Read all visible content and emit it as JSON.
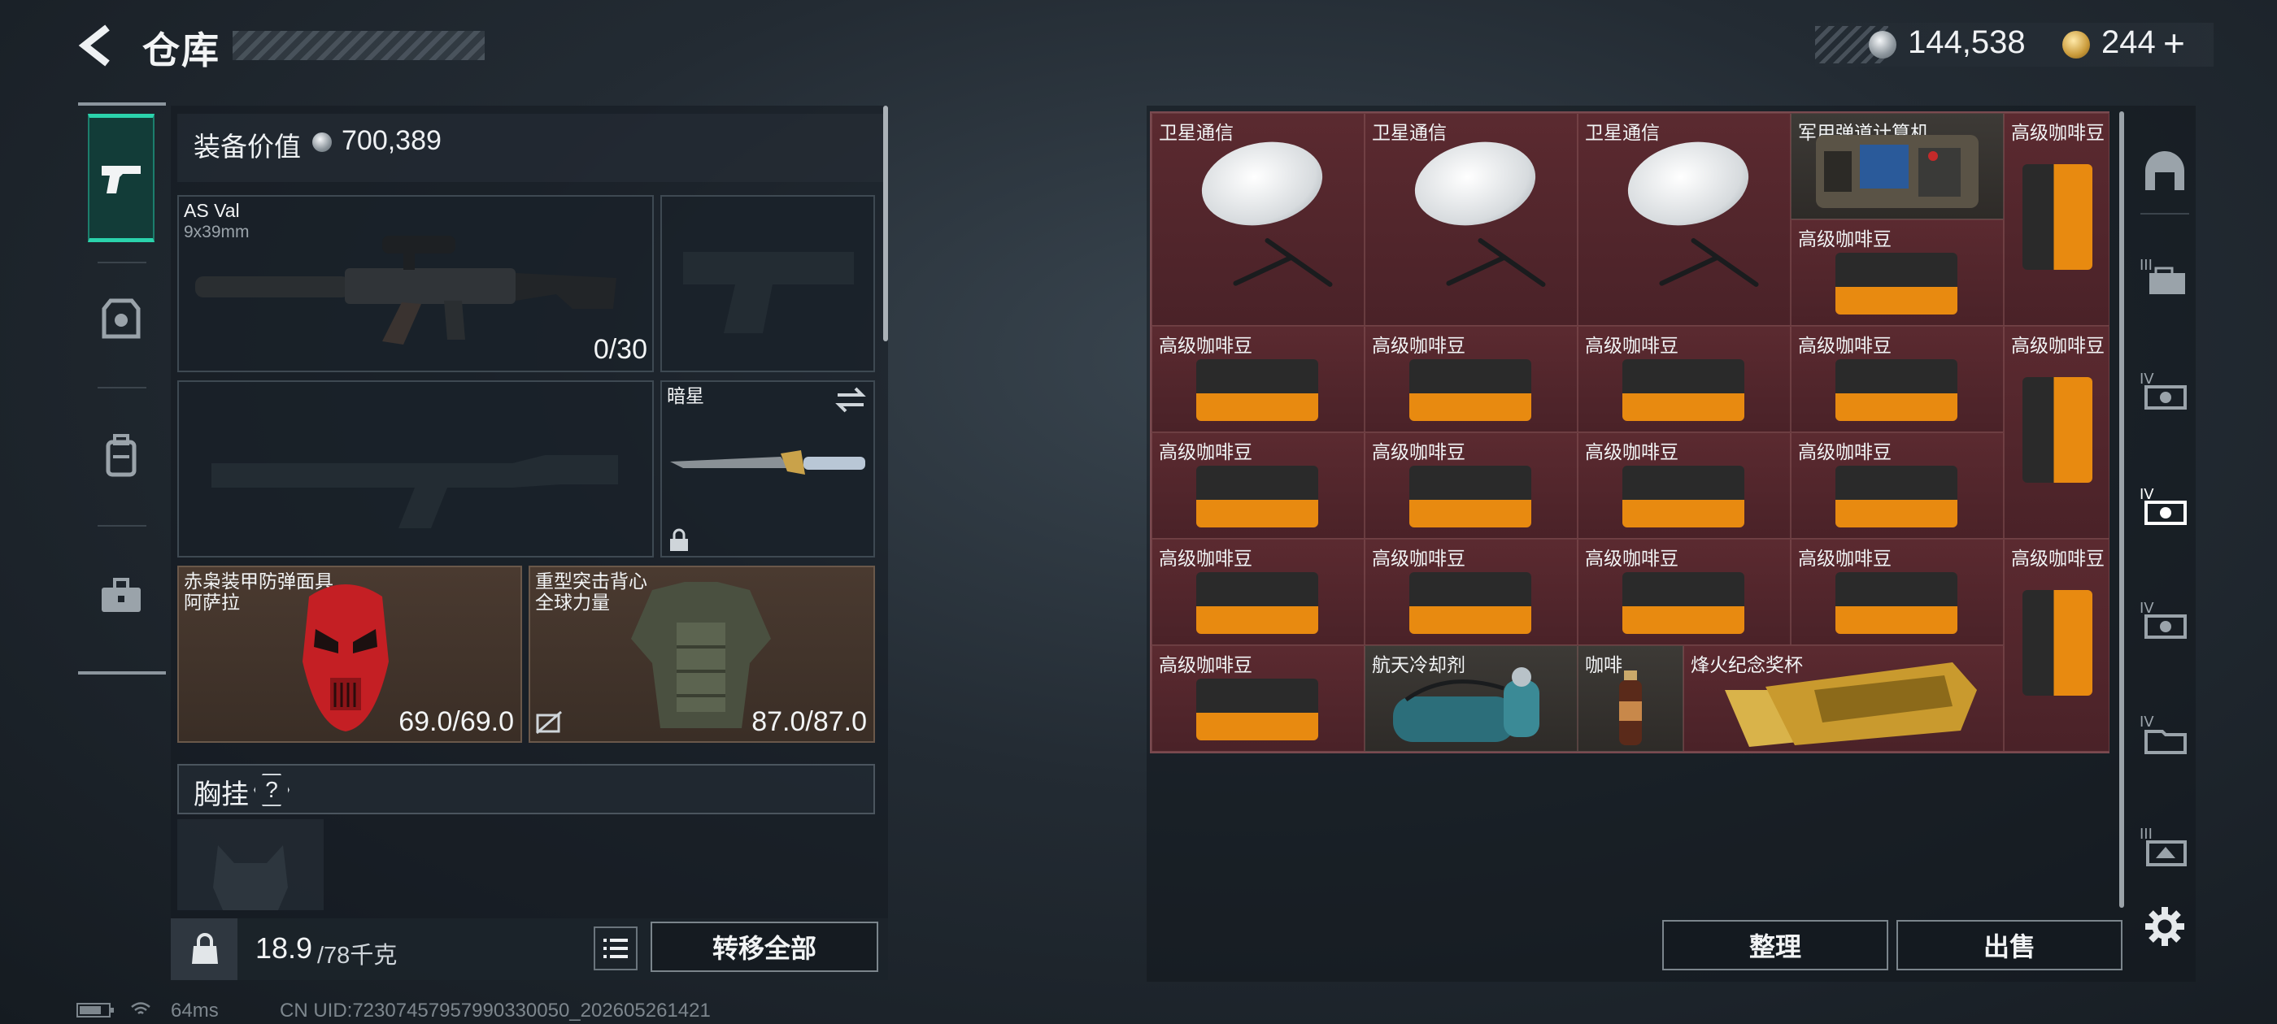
{
  "header": {
    "title": "仓库"
  },
  "currency": {
    "silver": "144,538",
    "gold": "244",
    "gold_suffix": "+"
  },
  "rail": [
    "pistol-icon",
    "armor-icon",
    "backpack-icon",
    "toolbox-icon"
  ],
  "loadout": {
    "equipment_value_label": "装备价值",
    "equipment_value": "700,389",
    "primary": {
      "name": "AS Val",
      "caliber": "9x39mm",
      "ammo": "0/30"
    },
    "melee": {
      "name": "暗星"
    },
    "helmet": {
      "name": "赤枭装甲防弹面具",
      "sub": "阿萨拉",
      "durability": "69.0/69.0"
    },
    "armor": {
      "name": "重型突击背心",
      "sub": "全球力量",
      "durability": "87.0/87.0"
    },
    "chest_rig_label": "胸挂",
    "chest_help": "?"
  },
  "bottom": {
    "weight_current": "18.9",
    "weight_max": "/78千克",
    "transfer_all": "转移全部"
  },
  "status": {
    "ping": "64ms",
    "uid": "CN UID:72307457957990330050_202605261421"
  },
  "storage": {
    "items": {
      "sat": "卫星通信",
      "computer": "军用弹道计算机",
      "coffee": "高级咖啡豆",
      "coolant": "航天冷却剂",
      "drink": "咖啡",
      "trophy": "烽火纪念奖杯"
    },
    "sort": "整理",
    "sell": "出售"
  },
  "right_rail": [
    "helmet-tab-icon",
    "tier-3-case-icon",
    "tier-4-case-icon",
    "tier-4-case-selected-icon",
    "tier-4-case-icon",
    "tier-4-case-icon",
    "tier-3-case-icon",
    "settings-gear-icon"
  ]
}
